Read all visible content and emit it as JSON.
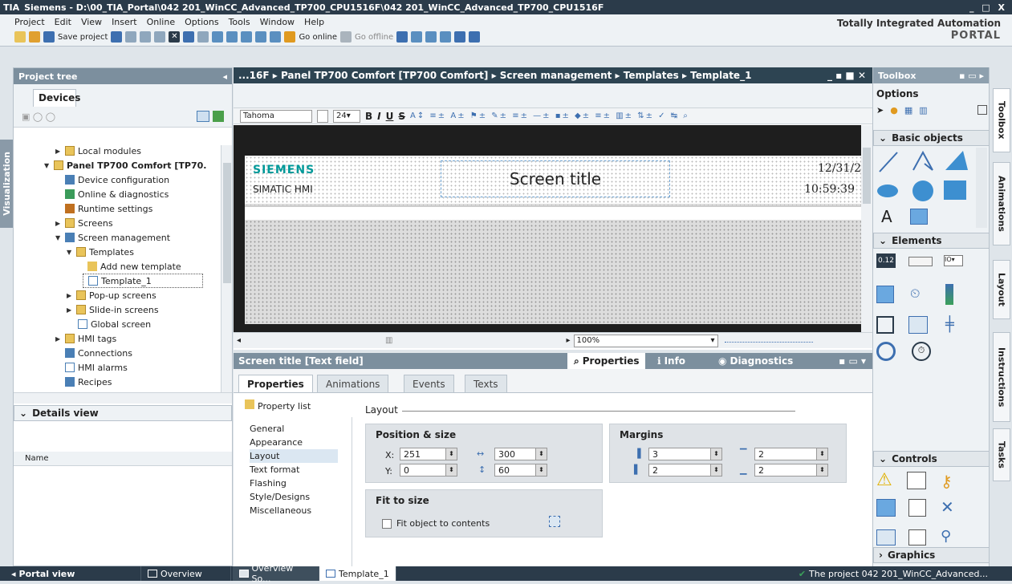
{
  "app": {
    "title": "Siemens - D:\\00_TIA_Portal\\042 201_WinCC_Advanced_TP700_CPU1516F\\042 201_WinCC_Advanced_TP700_CPU1516F",
    "logo": "TIA",
    "window_controls": "_ □ X"
  },
  "menu": [
    "Project",
    "Edit",
    "View",
    "Insert",
    "Online",
    "Options",
    "Tools",
    "Window",
    "Help"
  ],
  "toolbar": {
    "save_label": "Save project",
    "go_online": "Go online",
    "go_offline": "Go offline"
  },
  "brand": {
    "line1": "Totally Integrated Automation",
    "line2": "PORTAL"
  },
  "left_tab": "Visualization",
  "project_tree": {
    "title": "Project tree",
    "devices_tab": "Devices",
    "items": [
      {
        "label": "Local modules"
      },
      {
        "label": "Panel TP700 Comfort [TP70."
      },
      {
        "label": "Device configuration"
      },
      {
        "label": "Online & diagnostics"
      },
      {
        "label": "Runtime settings"
      },
      {
        "label": "Screens"
      },
      {
        "label": "Screen management"
      },
      {
        "label": "Templates"
      },
      {
        "label": "Add new template"
      },
      {
        "label": "Template_1"
      },
      {
        "label": "Pop-up screens"
      },
      {
        "label": "Slide-in screens"
      },
      {
        "label": "Global screen"
      },
      {
        "label": "HMI tags"
      },
      {
        "label": "Connections"
      },
      {
        "label": "HMI alarms"
      },
      {
        "label": "Recipes"
      }
    ],
    "details_title": "Details view",
    "details_col": "Name"
  },
  "editor": {
    "breadcrumb": "...16F ▸ Panel TP700 Comfort [TP700 Comfort] ▸ Screen management ▸ Templates ▸ Template_1",
    "font": "Tahoma",
    "font_size": "24",
    "fmt_buttons": [
      "B",
      "I",
      "U",
      "S"
    ],
    "hmi": {
      "brand": "SIEMENS",
      "subbrand": "SIMATIC HMI",
      "title": "Screen title",
      "date": "12/31/2",
      "time": "10:59:39"
    },
    "zoom": "100%"
  },
  "properties": {
    "header": "Screen title [Text field]",
    "top_tabs": [
      "Properties",
      "Info",
      "Diagnostics"
    ],
    "tabs": [
      "Properties",
      "Animations",
      "Events",
      "Texts"
    ],
    "property_list": "Property list",
    "side_menu": [
      "General",
      "Appearance",
      "Layout",
      "Text format",
      "Flashing",
      "Style/Designs",
      "Miscellaneous"
    ],
    "section": "Layout",
    "pos_size": {
      "title": "Position & size",
      "x_label": "X:",
      "x": "251",
      "y_label": "Y:",
      "y": "0",
      "w": "300",
      "h": "60"
    },
    "margins": {
      "title": "Margins",
      "left": "3",
      "right": "2",
      "top": "2",
      "bottom": "2"
    },
    "fit": {
      "title": "Fit to size",
      "checkbox": "Fit object to contents"
    }
  },
  "toolbox": {
    "title": "Toolbox",
    "options": "Options",
    "basic_objects": "Basic objects",
    "elements": "Elements",
    "controls": "Controls",
    "graphics": "Graphics",
    "text_a": "A"
  },
  "right_tabs": [
    "Toolbox",
    "Animations",
    "Layout",
    "Instructions",
    "Tasks"
  ],
  "status": {
    "portal_view": "Portal view",
    "overview": "Overview",
    "tab1": "Overview So...",
    "tab2": "Template_1",
    "message": "The project 042 201_WinCC_Advanced..."
  }
}
